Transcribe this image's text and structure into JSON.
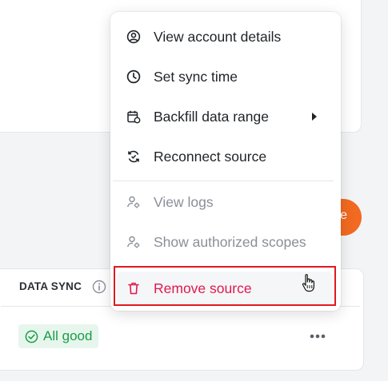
{
  "table": {
    "col_data_sync": "DATA SYNC",
    "status_badge": "All good"
  },
  "orange_button": {
    "label": "e"
  },
  "menu": {
    "items": [
      {
        "label": "View account details",
        "icon": "user-circle-icon",
        "disabled": false
      },
      {
        "label": "Set sync time",
        "icon": "clock-icon",
        "disabled": false
      },
      {
        "label": "Backfill data range",
        "icon": "calendar-refresh-icon",
        "disabled": false,
        "submenu": true
      },
      {
        "label": "Reconnect source",
        "icon": "reconnect-icon",
        "disabled": false
      },
      {
        "label": "View logs",
        "icon": "user-gear-icon",
        "disabled": true
      },
      {
        "label": "Show authorized scopes",
        "icon": "user-gear-icon",
        "disabled": true
      },
      {
        "label": "Remove source",
        "icon": "trash-icon",
        "disabled": false,
        "danger": true
      }
    ]
  },
  "colors": {
    "danger": "#e0194e",
    "success": "#1a9c4a",
    "accent": "#f26a21",
    "highlight_box": "#e0191f"
  }
}
